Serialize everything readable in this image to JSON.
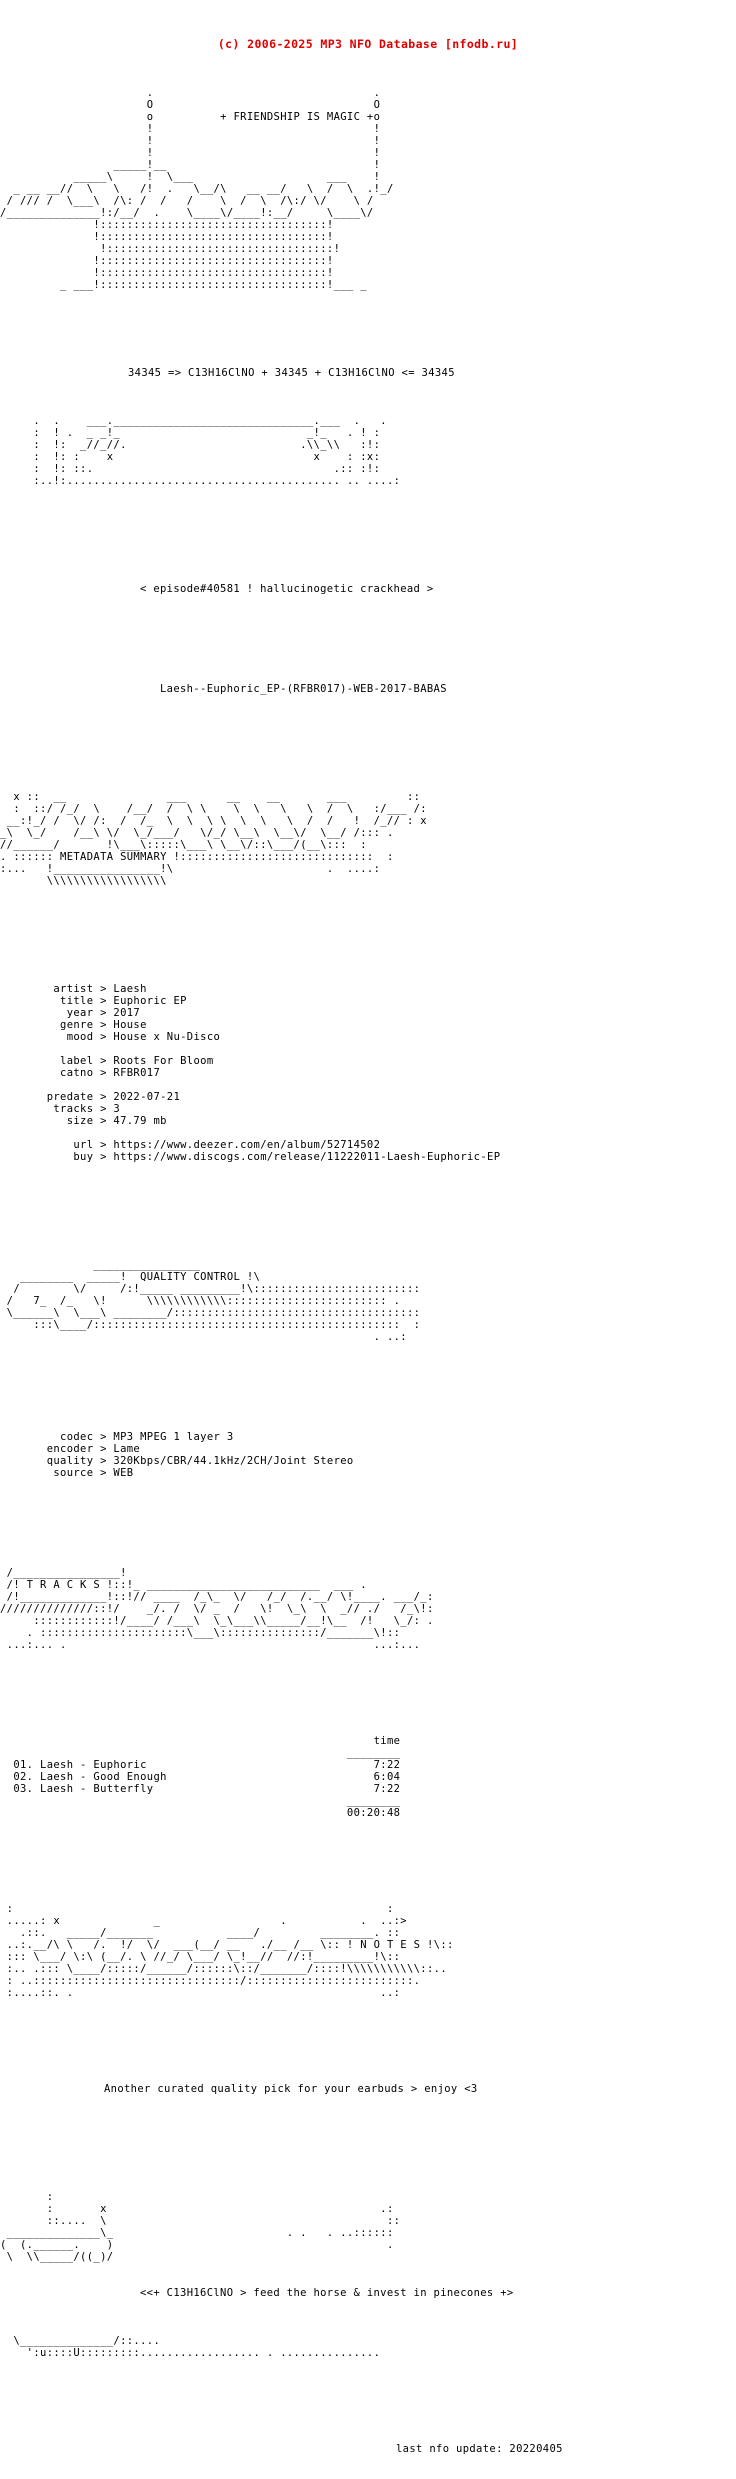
{
  "header": {
    "copyright": "(c) 2006-2025 MP3 NFO Database [nfodb.ru]",
    "color": "#e00000"
  },
  "banner": {
    "tagline": "+ FRIENDSHIP IS MAGIC +",
    "formula_line": "34345 => C13H16ClNO + 34345 + C13H16ClNO <= 34345",
    "art_top": "                      .                                 .\n                      O                                 O\n                      o          + FRIENDSHIP IS MAGIC +o\n                      !                                 !\n                      !                                 !\n                      !                                 !\n                 _____!__                               !\n           _____\\     !  \\___                    ___    !\n  _ __ __//  \\   \\   /!  .   \\__/\\   __ __/   \\  /  \\  .!_/\n / /// /  \\___\\  /\\: /  /   /    \\  /  \\  /\\:/ \\/    \\ /\n/______________!:/__/  .    \\____\\/____!:__/     \\____\\/\n              !::::::::::::::::::::::::::::::::::!\n              !::::::::::::::::::::::::::::::::::!\n               !::::::::::::::::::::::::::::::::::!\n              !::::::::::::::::::::::::::::::::::!\n              !::::::::::::::::::::::::::::::::::!\n         _ ___!::::::::::::::::::::::::::::::::::!___ _",
    "art_bottom": "     .  .    ___.______________________________.___  .   .\n     :  ! .  _ _!_                            _!_   . ! :\n     :  !:  _//_//.                          .\\\\_\\\\   :!:\n     :  !: :    x                              x    : :x:\n     :  !: ::.                                    .:: :!:\n     :..!:......................................... .. ....:"
  },
  "episode": {
    "line": "< episode#40581 ! hallucinogetic crackhead >"
  },
  "release": {
    "dirname": "Laesh--Euphoric_EP-(RFBR017)-WEB-2017-BABAS"
  },
  "sections": {
    "metadata_summary": {
      "title": "METADATA SUMMARY",
      "fields": [
        {
          "label": "artist",
          "sep": ">",
          "value": "Laesh"
        },
        {
          "label": "title",
          "sep": ">",
          "value": "Euphoric EP"
        },
        {
          "label": "year",
          "sep": ">",
          "value": "2017"
        },
        {
          "label": "genre",
          "sep": ">",
          "value": "House"
        },
        {
          "label": "mood",
          "sep": ">",
          "value": "House x Nu-Disco"
        },
        {
          "label": "label",
          "sep": ">",
          "value": "Roots For Bloom"
        },
        {
          "label": "catno",
          "sep": ">",
          "value": "RFBR017"
        },
        {
          "label": "predate",
          "sep": ">",
          "value": "2022-07-21"
        },
        {
          "label": "tracks",
          "sep": ">",
          "value": "3"
        },
        {
          "label": "size",
          "sep": ">",
          "value": "47.79 mb"
        },
        {
          "label": "url",
          "sep": ">",
          "value": "https://www.deezer.com/en/album/52714502"
        },
        {
          "label": "buy",
          "sep": ">",
          "value": "https://www.discogs.com/release/11222011-Laesh-Euphoric-EP"
        }
      ],
      "block": "        artist > Laesh\n         title > Euphoric EP\n          year > 2017\n         genre > House\n          mood > House x Nu-Disco\n\n         label > Roots For Bloom\n         catno > RFBR017\n\n       predate > 2022-07-21\n        tracks > 3\n          size > 47.79 mb\n\n           url > https://www.deezer.com/en/album/52714502\n           buy > https://www.discogs.com/release/11222011-Laesh-Euphoric-EP"
    },
    "quality_control": {
      "title": "QUALITY CONTROL",
      "fields": [
        {
          "label": "codec",
          "sep": ">",
          "value": "MP3 MPEG 1 layer 3"
        },
        {
          "label": "encoder",
          "sep": ">",
          "value": "Lame"
        },
        {
          "label": "quality",
          "sep": ">",
          "value": "320Kbps/CBR/44.1kHz/2CH/Joint Stereo"
        },
        {
          "label": "source",
          "sep": ">",
          "value": "WEB"
        }
      ],
      "block": "         codec > MP3 MPEG 1 layer 3\n       encoder > Lame\n       quality > 320Kbps/CBR/44.1kHz/2CH/Joint Stereo\n        source > WEB"
    },
    "tracks": {
      "title": "T R A C K S",
      "time_header": "time",
      "rule": "________",
      "items": [
        {
          "num": "01.",
          "name": "Laesh - Euphoric",
          "time": "7:22"
        },
        {
          "num": "02.",
          "name": "Laesh - Good Enough",
          "time": "6:04"
        },
        {
          "num": "03.",
          "name": "Laesh - Butterfly",
          "time": "7:22"
        }
      ],
      "total": "00:20:48",
      "block": "                                                        time\n                                                    ________\n  01. Laesh - Euphoric                                  7:22\n  02. Laesh - Good Enough                               6:04\n  03. Laesh - Butterfly                                 7:22\n                                                    ________\n                                                    00:20:48"
    },
    "notes": {
      "title": "N O T E S",
      "message": "Another curated quality pick for your earbuds > enjoy <3"
    }
  },
  "footer": {
    "slogan": "<<+ C13H16ClNO > feed the horse & invest in pinecones +>",
    "last_update_label": "last nfo update:",
    "last_update_value": "20220405",
    "last_update_line": "last nfo update: 20220405",
    "art": "       :\n       :       x                                         .:\n       ::....  \\                                          ::\n ______________\\_                          . .   . ..::::::\n(  (.______.    )                                         .\n \\  \\\\_____/((_)/ ",
    "art_tail": "  \\______________/::....\n    ':u::::U:::::::::.................. . ..............."
  },
  "banners": {
    "metadata_art": "  x ::  __               ___      __    __       ___         ::\n  :  ::/ /_/  \\    /__/  /  \\ \\    \\  \\   \\   \\  /  \\   :/___ /:\n __:!_/ /  \\/ /:  /  /_  \\  \\  \\ \\  \\  \\   \\  /  /   !  /_// : x\n_\\  \\_/    /__\\ \\/  \\_/___/   \\/_/ \\__\\  \\__\\/  \\__/ /::: .\n//______/       !\\___\\:::::\\___\\ \\__\\/::\\___/(__\\:::  :\n. :::::: METADATA SUMMARY !:::::::::::::::::::::::::::::  :\n:...   !________________!\\                       .  ....:\n       \\\\\\\\\\\\\\\\\\\\\\\\\\\\\\\\\\\\",
    "quality_art": "              ________________\n   ________  _____!  QUALITY CONTROL !\\\n  /        \\/     /:!_____ _________!\\:::::::::::::::::::::::::\n /   7_  /_   \\!      \\\\\\\\\\\\\\\\\\\\\\\\:::::::::::::::::::::::: .\n \\______\\  \\___\\ ________/:::::::::::::::::::::::::::::::::::::\n     :::\\____/::::::::::::::::::::::::::::::::::::::::::::::  :\n                                                        . ..:",
    "tracks_art": " /________________!\n /! T R A C K S !::!_ __________________________  ___ .\n /!_____________!::!// ____  /_\\_  \\/   /_/  /.__/ \\!____. ___/_:\n//////////////::!/    _/. /  \\/ _  /   \\!  \\_\\  \\  _// ./   /_\\!:\n     ::::::::::::!/____/ /___\\  \\_\\___\\\\_____/__!\\__  /!   \\_/: .\n    . ::::::::::::::::::::::\\___\\:::::::::::::::/_______\\!::\n ...:... .                                              ...:...",
    "notes_art": " :                                                        :\n .....: x              _                  .           .  ..:>\n   .::.   _____/_______           ____/         ________. ::\n ..:.__/\\ \\   /.  !/  \\/  ___(__/ __   ./__ /__ \\:: ! N O T E S !\\::\n ::: \\___/ \\:\\ (__/. \\ //_/ \\___/ \\_!__//  //:!_________!\\::\n :.. .::: \\____/:::::/______/::::::\\::/_______/::::!\\\\\\\\\\\\\\\\\\\\\\::..\n : ..:::::::::::::::::::::::::::::::/:::::::::::::::::::::::::.\n :....::. .                                              ..:"
  }
}
